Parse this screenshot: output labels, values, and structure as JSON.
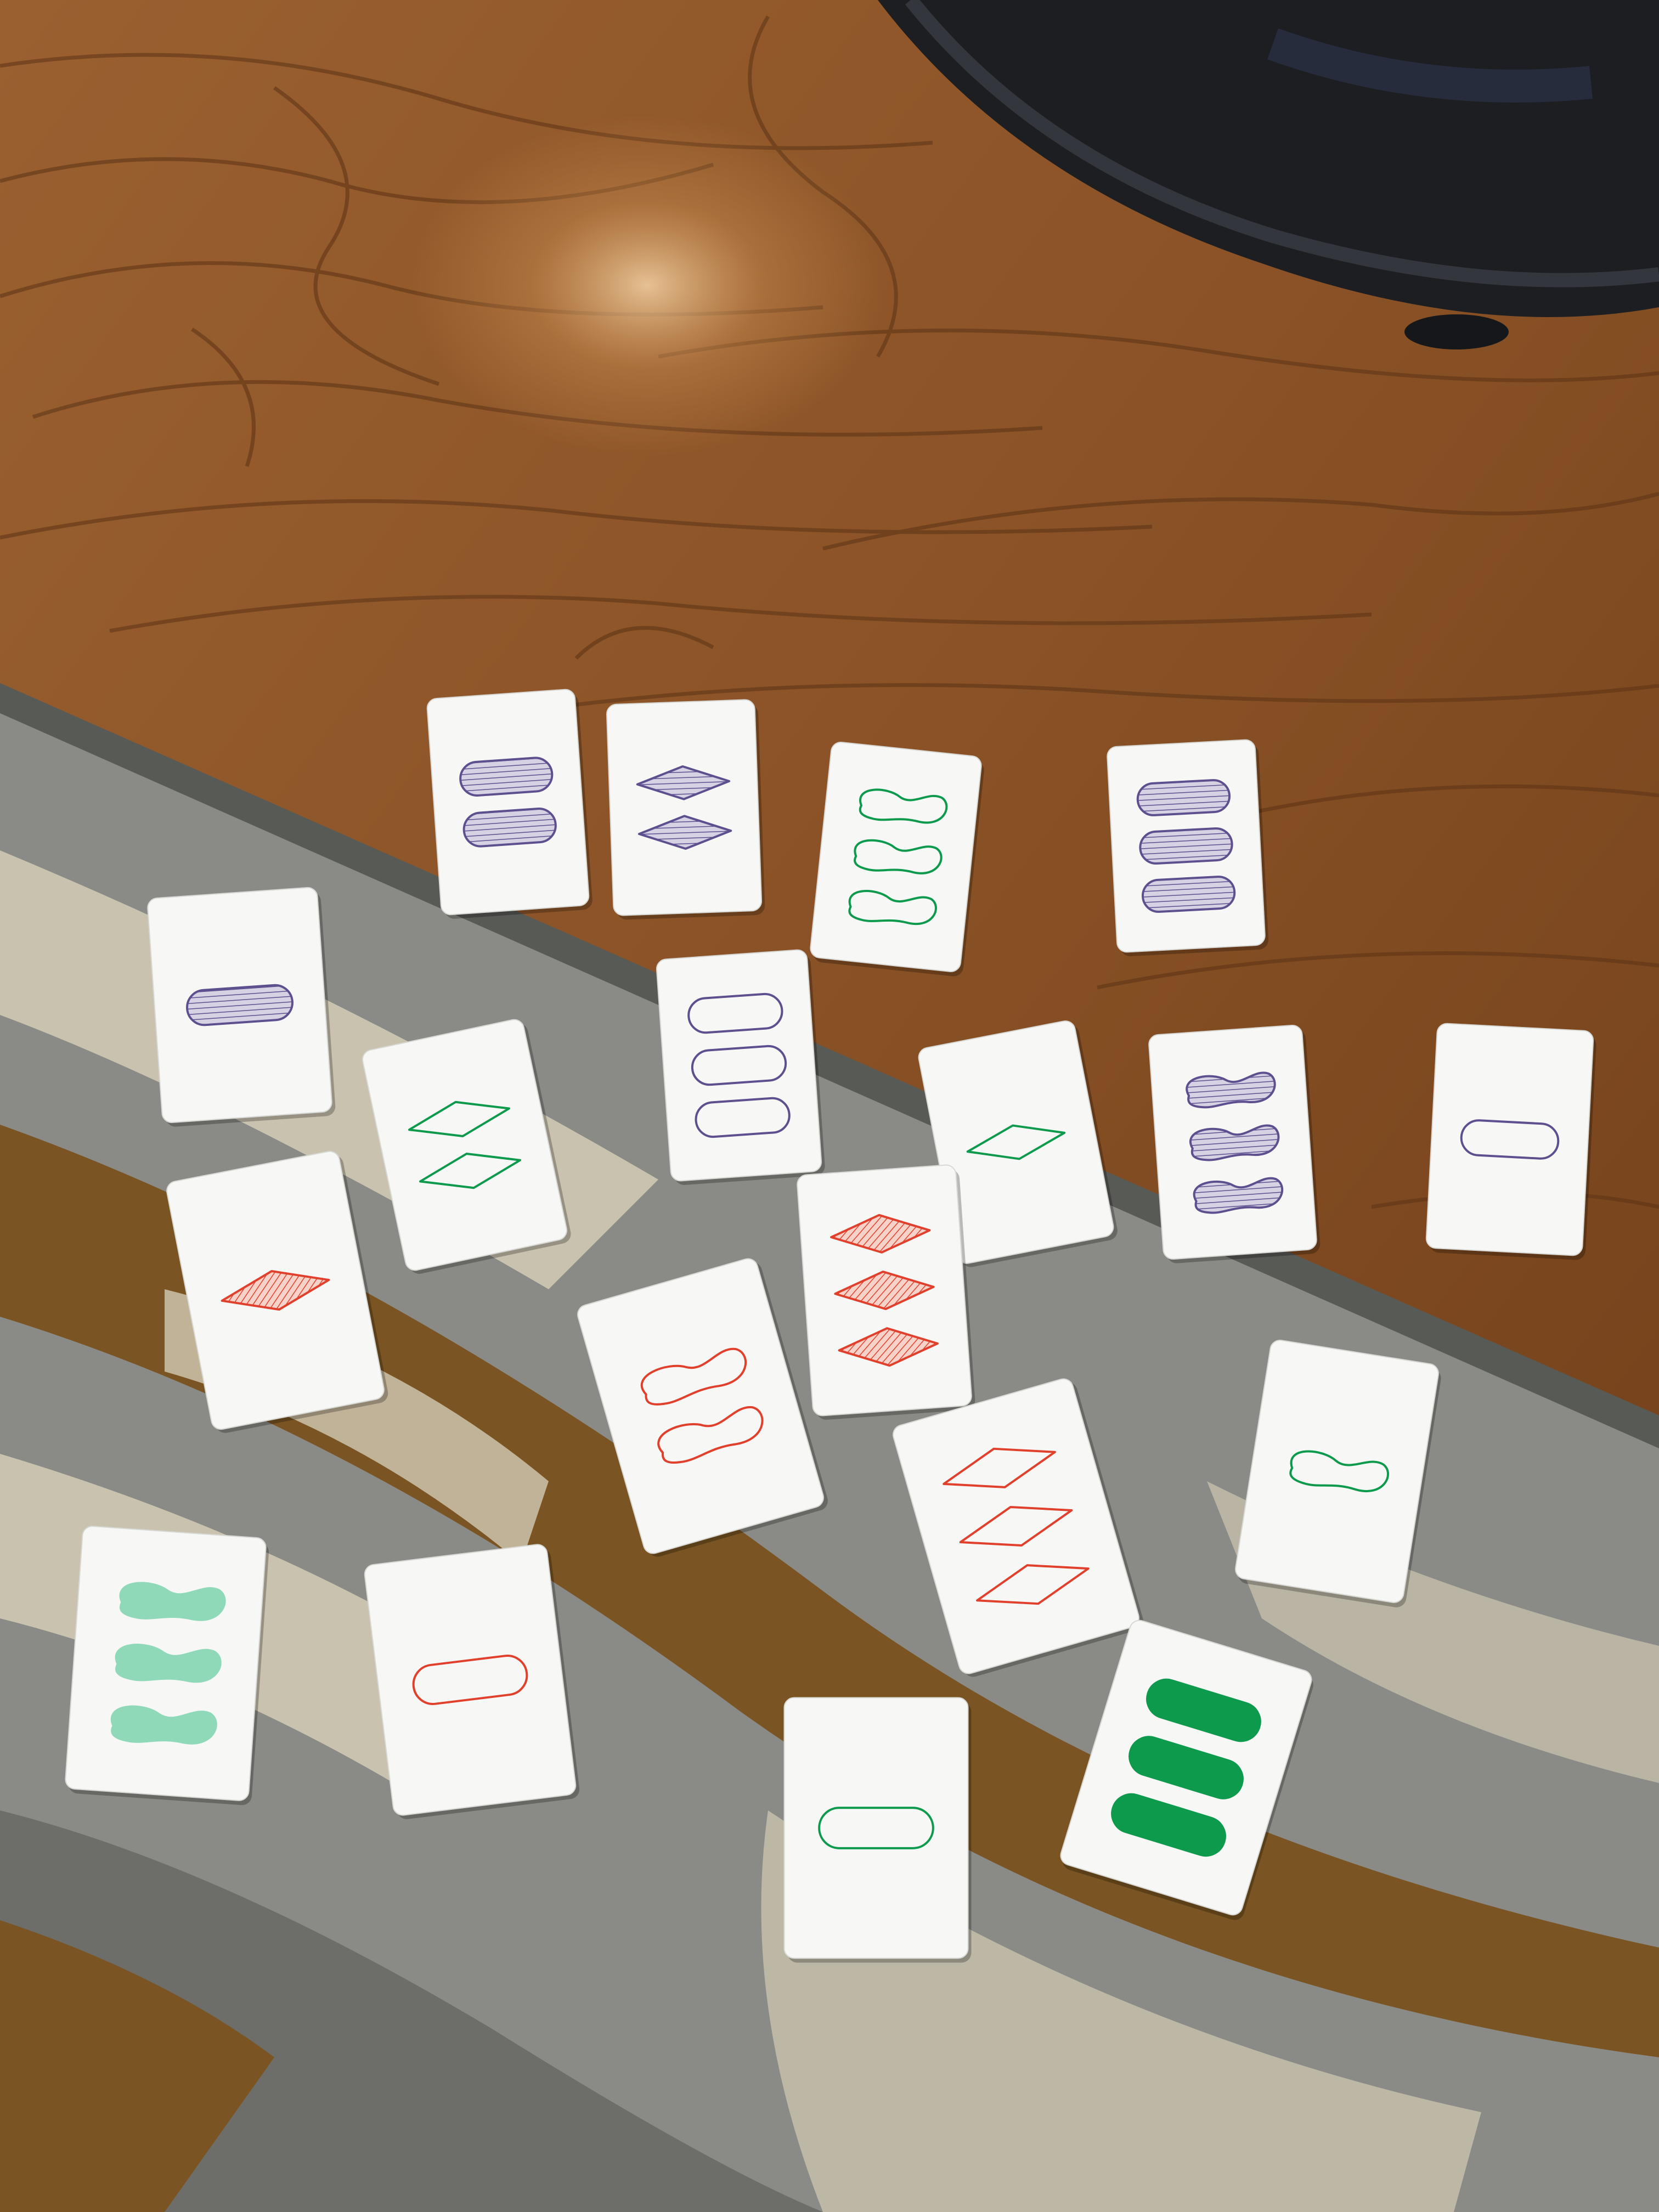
{
  "scene": {
    "description_colors": {
      "floor": "#8a5428",
      "floor_grain": "#5c3315",
      "rug_gray": "#8a8a86",
      "rug_light": "#c9c2ae",
      "rug_brown": "#7a5422",
      "basket": "#1c1e22",
      "card": "#f7f7f5"
    },
    "symbol_colors": {
      "purple": "#5e4f8f",
      "green": "#0e9a4c",
      "red": "#e0402c",
      "light-green": "#8fd9b9"
    }
  },
  "cards": [
    {
      "id": "purple-2-oval-striped",
      "count": 2,
      "shape": "oval",
      "color": "purple",
      "fill": "striped"
    },
    {
      "id": "purple-2-diamond-striped",
      "count": 2,
      "shape": "diamond",
      "color": "purple",
      "fill": "striped"
    },
    {
      "id": "green-3-squiggle-open",
      "count": 3,
      "shape": "squiggle",
      "color": "green",
      "fill": "open"
    },
    {
      "id": "purple-3-oval-striped",
      "count": 3,
      "shape": "oval",
      "color": "purple",
      "fill": "striped"
    },
    {
      "id": "purple-1-oval-striped",
      "count": 1,
      "shape": "oval",
      "color": "purple",
      "fill": "striped"
    },
    {
      "id": "purple-3-oval-open",
      "count": 3,
      "shape": "oval",
      "color": "purple",
      "fill": "open"
    },
    {
      "id": "green-2-diamond-open",
      "count": 2,
      "shape": "diamond",
      "color": "green",
      "fill": "open"
    },
    {
      "id": "green-1-diamond-open",
      "count": 1,
      "shape": "diamond",
      "color": "green",
      "fill": "open"
    },
    {
      "id": "purple-3-squiggle-striped",
      "count": 3,
      "shape": "squiggle",
      "color": "purple",
      "fill": "striped"
    },
    {
      "id": "purple-1-oval-open",
      "count": 1,
      "shape": "oval",
      "color": "purple",
      "fill": "open"
    },
    {
      "id": "red-1-diamond-striped",
      "count": 1,
      "shape": "diamond",
      "color": "red",
      "fill": "striped"
    },
    {
      "id": "red-3-diamond-striped",
      "count": 3,
      "shape": "diamond",
      "color": "red",
      "fill": "striped"
    },
    {
      "id": "red-2-squiggle-open",
      "count": 2,
      "shape": "squiggle",
      "color": "red",
      "fill": "open"
    },
    {
      "id": "green-1-squiggle-open",
      "count": 1,
      "shape": "squiggle",
      "color": "green",
      "fill": "open"
    },
    {
      "id": "red-3-diamond-open",
      "count": 3,
      "shape": "diamond",
      "color": "red",
      "fill": "open"
    },
    {
      "id": "green-3-squiggle-solid",
      "count": 3,
      "shape": "squiggle",
      "color": "light-green",
      "fill": "solid"
    },
    {
      "id": "red-1-oval-open",
      "count": 1,
      "shape": "oval",
      "color": "red",
      "fill": "open"
    },
    {
      "id": "green-1-oval-open",
      "count": 1,
      "shape": "oval",
      "color": "green",
      "fill": "open"
    },
    {
      "id": "green-3-oval-solid",
      "count": 3,
      "shape": "oval",
      "color": "green",
      "fill": "solid"
    }
  ]
}
